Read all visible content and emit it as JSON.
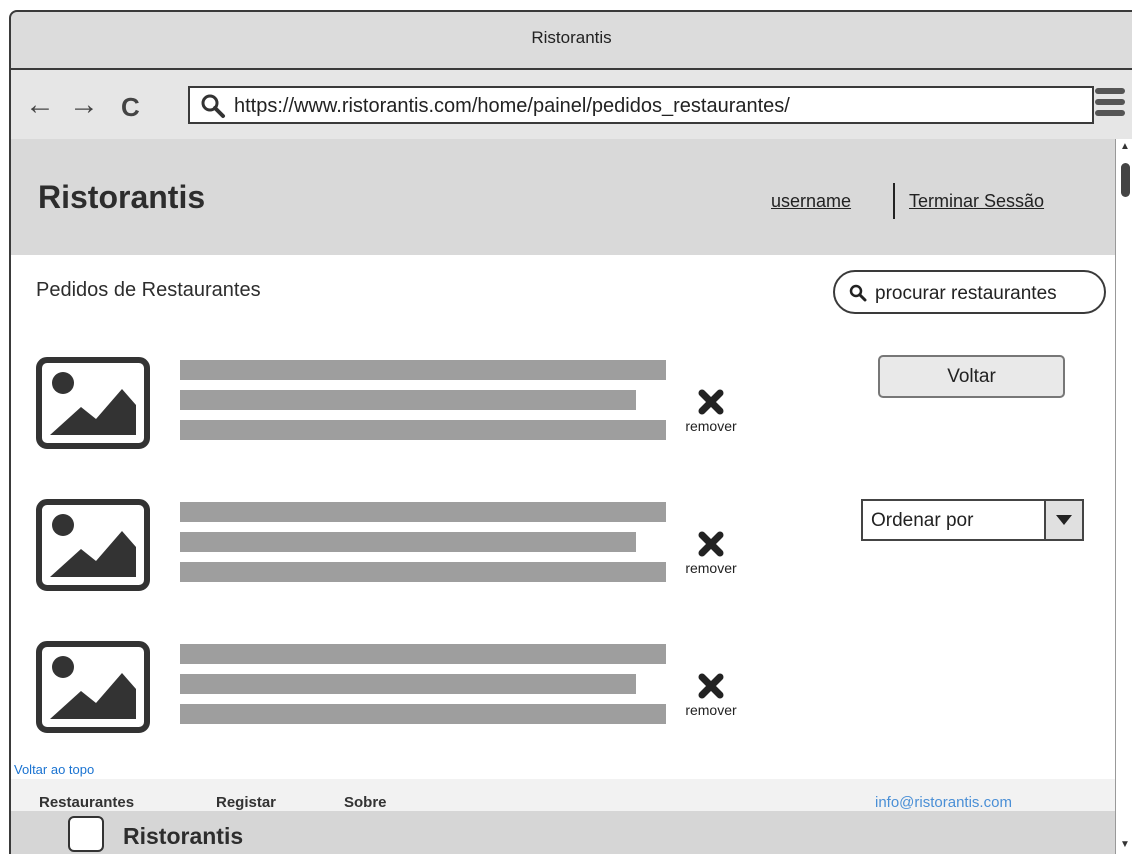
{
  "window": {
    "title": "Ristorantis"
  },
  "browser": {
    "url": "https://www.ristorantis.com/home/painel/pedidos_restaurantes/",
    "back_glyph": "←",
    "forward_glyph": "→",
    "reload_glyph": "C"
  },
  "header": {
    "logo": "Ristorantis",
    "username": "username",
    "logout": "Terminar Sessão"
  },
  "main": {
    "heading": "Pedidos de Restaurantes",
    "search_placeholder": "procurar restaurantes",
    "back_button": "Voltar",
    "sort_label": "Ordenar por",
    "items": [
      {
        "remove_label": "remover"
      },
      {
        "remove_label": "remover"
      },
      {
        "remove_label": "remover"
      }
    ],
    "back_to_top": "Voltar ao topo"
  },
  "footer": {
    "links": [
      "Restaurantes",
      "Registar",
      "Sobre"
    ],
    "email": "info@ristorantis.com",
    "logo": "Ristorantis"
  },
  "icons": {
    "image_placeholder": "image-icon",
    "remove": "close-icon",
    "search": "search-icon",
    "menu": "hamburger-menu-icon",
    "dropdown": "chevron-down-icon"
  }
}
